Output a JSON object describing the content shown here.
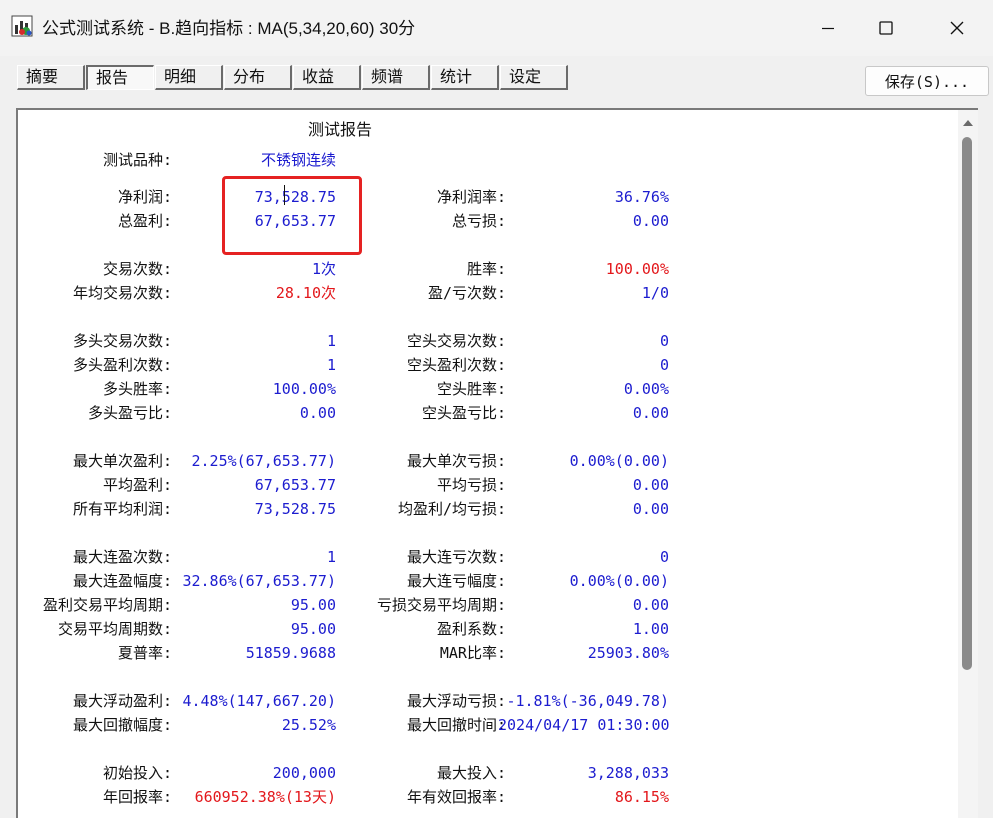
{
  "window": {
    "title": "公式测试系统 - B.趋向指标 : MA(5,34,20,60) 30分",
    "icons": {
      "app": "chart-app-icon",
      "minimize": "minimize-icon",
      "maximize": "maximize-icon",
      "close": "close-icon"
    }
  },
  "tabs": [
    {
      "label": "摘要",
      "active": false
    },
    {
      "label": "报告",
      "active": true
    },
    {
      "label": "明细",
      "active": false
    },
    {
      "label": "分布",
      "active": false
    },
    {
      "label": "收益",
      "active": false
    },
    {
      "label": "频谱",
      "active": false
    },
    {
      "label": "统计",
      "active": false
    },
    {
      "label": "设定",
      "active": false
    }
  ],
  "save_button": "保存(S)...",
  "report": {
    "title": "测试报告",
    "rows": [
      {
        "l1": "测试品种:",
        "v1": "不锈钢连续",
        "c1": "blue"
      },
      {
        "l1": "净利润:",
        "v1": "73,528.75",
        "c1": "blue",
        "l2": "净利润率:",
        "v2": "36.76%",
        "c2": "blue"
      },
      {
        "l1": "总盈利:",
        "v1": "67,653.77",
        "c1": "blue",
        "l2": "总亏损:",
        "v2": "0.00",
        "c2": "blue"
      },
      {
        "l1": "交易次数:",
        "v1": "1次",
        "c1": "blue",
        "l2": "胜率:",
        "v2": "100.00%",
        "c2": "red"
      },
      {
        "l1": "年均交易次数:",
        "v1": "28.10次",
        "c1": "red",
        "l2": "盈/亏次数:",
        "v2": "1/0",
        "c2": "blue"
      },
      {
        "l1": "多头交易次数:",
        "v1": "1",
        "c1": "blue",
        "l2": "空头交易次数:",
        "v2": "0",
        "c2": "blue"
      },
      {
        "l1": "多头盈利次数:",
        "v1": "1",
        "c1": "blue",
        "l2": "空头盈利次数:",
        "v2": "0",
        "c2": "blue"
      },
      {
        "l1": "多头胜率:",
        "v1": "100.00%",
        "c1": "blue",
        "l2": "空头胜率:",
        "v2": "0.00%",
        "c2": "blue"
      },
      {
        "l1": "多头盈亏比:",
        "v1": "0.00",
        "c1": "blue",
        "l2": "空头盈亏比:",
        "v2": "0.00",
        "c2": "blue"
      },
      {
        "l1": "最大单次盈利:",
        "v1": "2.25%(67,653.77)",
        "c1": "blue",
        "l2": "最大单次亏损:",
        "v2": "0.00%(0.00)",
        "c2": "blue"
      },
      {
        "l1": "平均盈利:",
        "v1": "67,653.77",
        "c1": "blue",
        "l2": "平均亏损:",
        "v2": "0.00",
        "c2": "blue"
      },
      {
        "l1": "所有平均利润:",
        "v1": "73,528.75",
        "c1": "blue",
        "l2": "均盈利/均亏损:",
        "v2": "0.00",
        "c2": "blue"
      },
      {
        "l1": "最大连盈次数:",
        "v1": "1",
        "c1": "blue",
        "l2": "最大连亏次数:",
        "v2": "0",
        "c2": "blue"
      },
      {
        "l1": "最大连盈幅度:",
        "v1": "32.86%(67,653.77)",
        "c1": "blue",
        "l2": "最大连亏幅度:",
        "v2": "0.00%(0.00)",
        "c2": "blue"
      },
      {
        "l1": "盈利交易平均周期:",
        "v1": "95.00",
        "c1": "blue",
        "l2": "亏损交易平均周期:",
        "v2": "0.00",
        "c2": "blue"
      },
      {
        "l1": "交易平均周期数:",
        "v1": "95.00",
        "c1": "blue",
        "l2": "盈利系数:",
        "v2": "1.00",
        "c2": "blue"
      },
      {
        "l1": "夏普率:",
        "v1": "51859.9688",
        "c1": "blue",
        "l2": "MAR比率:",
        "v2": "25903.80%",
        "c2": "blue"
      },
      {
        "l1": "最大浮动盈利:",
        "v1": "4.48%(147,667.20)",
        "c1": "blue",
        "l2": "最大浮动亏损:",
        "v2": "-1.81%(-36,049.78)",
        "c2": "blue"
      },
      {
        "l1": "最大回撤幅度:",
        "v1": "25.52%",
        "c1": "blue",
        "l2": "最大回撤时间:",
        "v2": "2024/04/17 01:30:00",
        "c2": "blue"
      },
      {
        "l1": "初始投入:",
        "v1": "200,000",
        "c1": "blue",
        "l2": "最大投入:",
        "v2": "3,288,033",
        "c2": "blue"
      },
      {
        "l1": "年回报率:",
        "v1": "660952.38%(13天)",
        "c1": "red",
        "l2": "年有效回报率:",
        "v2": "86.15%",
        "c2": "red"
      }
    ]
  }
}
